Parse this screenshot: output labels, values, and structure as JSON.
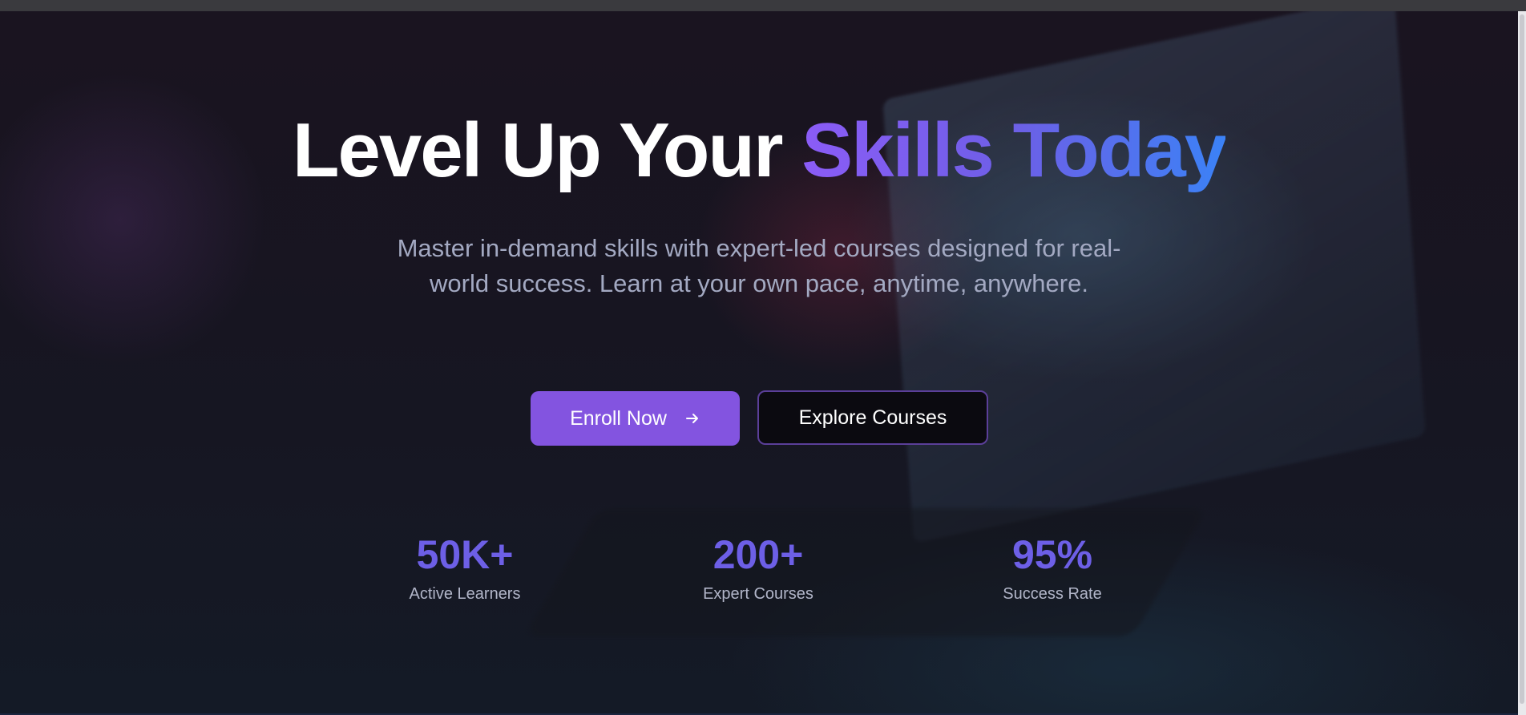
{
  "hero": {
    "headline_plain": "Level Up Your ",
    "headline_accent": "Skills Today",
    "subtitle": "Master in-demand skills with expert-led courses designed for real-world success. Learn at your own pace, anytime, anywhere."
  },
  "actions": {
    "enroll_label": "Enroll Now",
    "enroll_icon": "arrow-right-icon",
    "explore_label": "Explore Courses"
  },
  "stats": [
    {
      "value": "50K+",
      "label": "Active Learners"
    },
    {
      "value": "200+",
      "label": "Expert Courses"
    },
    {
      "value": "95%",
      "label": "Success Rate"
    }
  ],
  "colors": {
    "accent_start": "#8b5cf6",
    "accent_end": "#3b82f6",
    "button_primary": "#8354e0",
    "stat_value": "#6d5fe6"
  }
}
